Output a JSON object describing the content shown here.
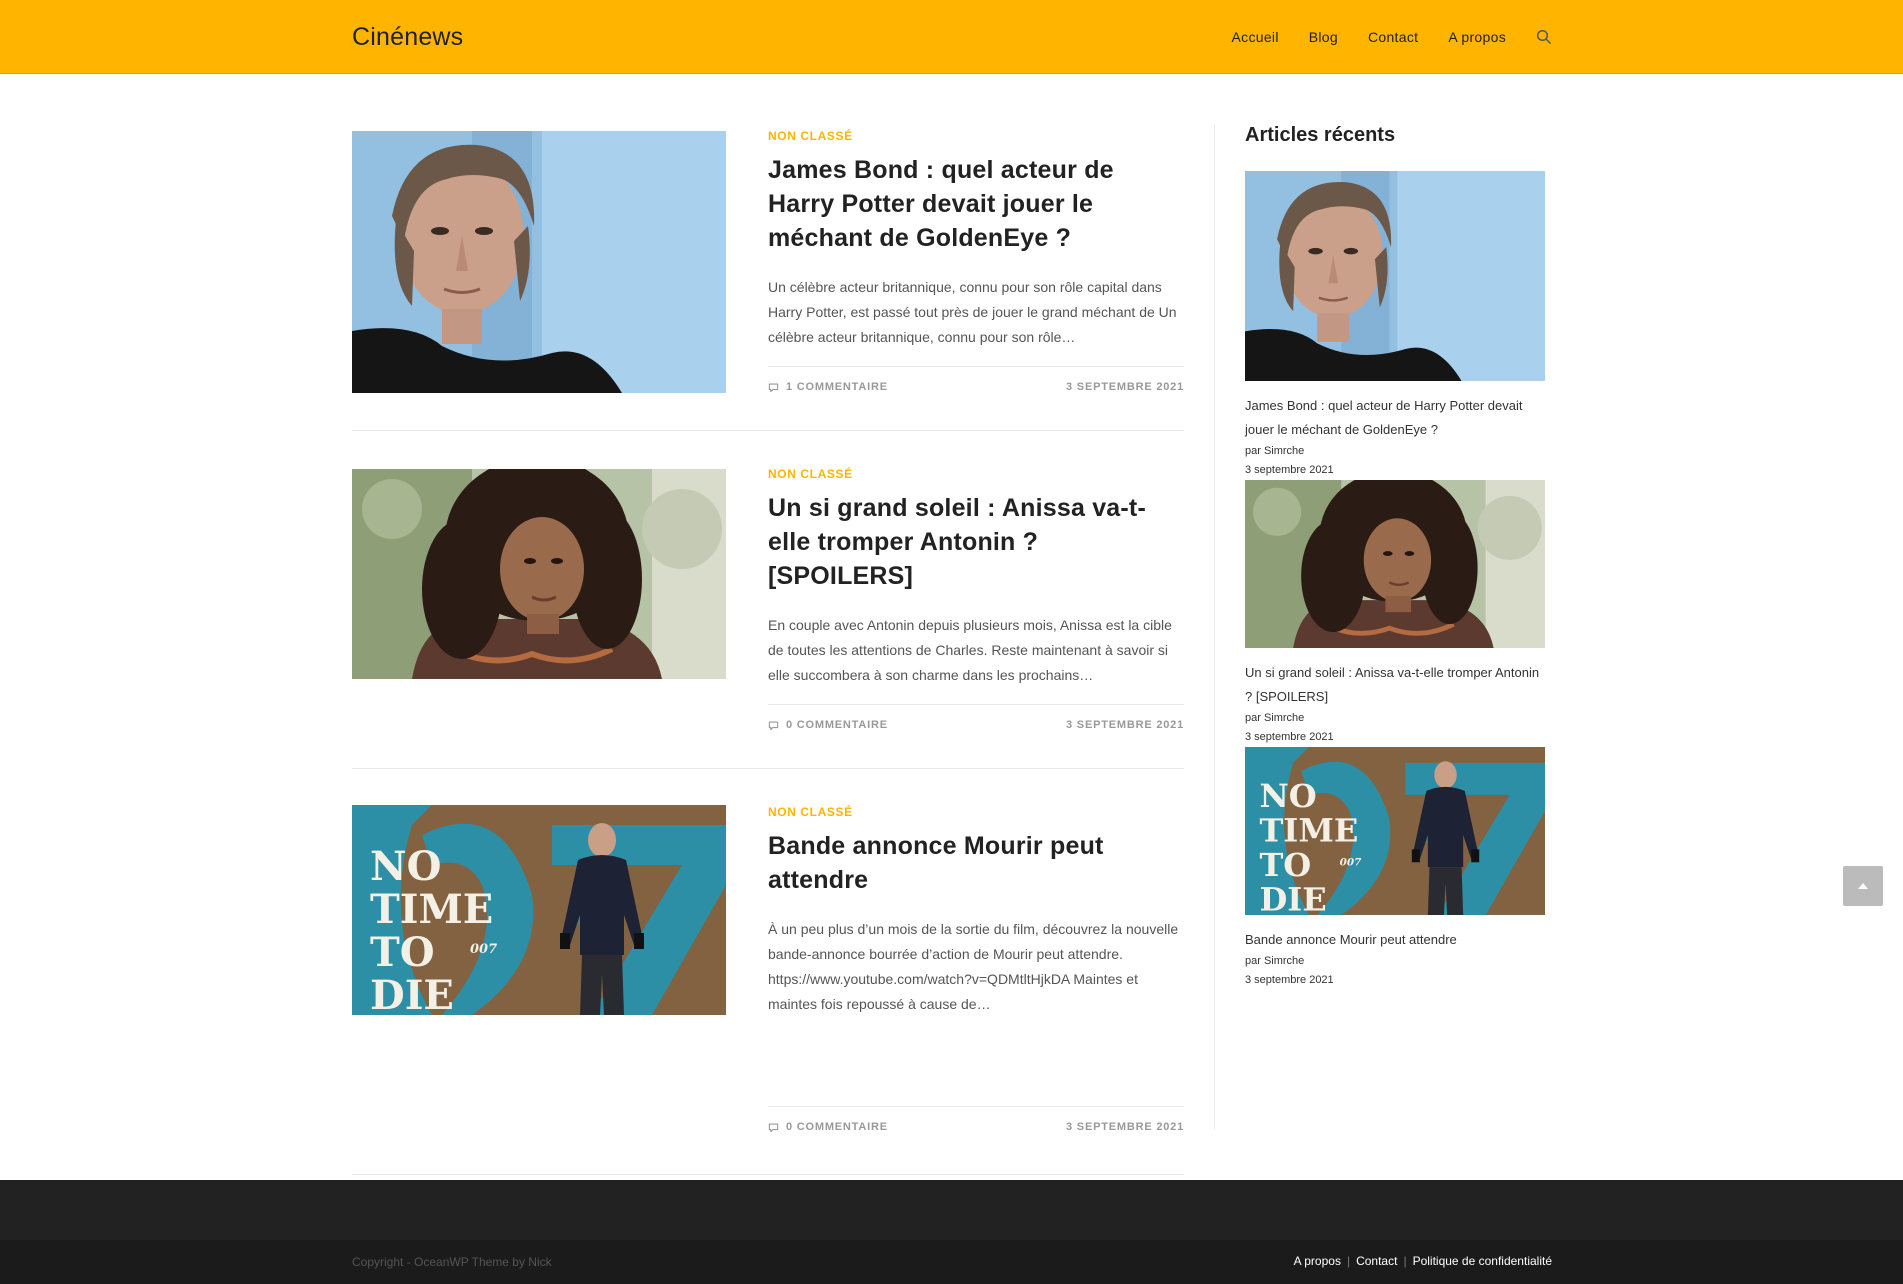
{
  "header": {
    "brand": "Cinénews",
    "nav": [
      "Accueil",
      "Blog",
      "Contact",
      "A propos"
    ]
  },
  "posts": [
    {
      "category": "Non classé",
      "title": "James Bond : quel acteur de Harry Potter devait jouer le méchant de GoldenEye ?",
      "excerpt": "Un célèbre acteur britannique, connu pour son rôle capital dans Harry Potter, est passé tout près de jouer le grand méchant de Un célèbre acteur britannique, connu pour son rôle…",
      "comments": "1 Commentaire",
      "date": "3 septembre 2021"
    },
    {
      "category": "Non classé",
      "title": "Un si grand soleil : Anissa va-t-elle tromper Antonin ? [SPOILERS]",
      "excerpt": "En couple avec Antonin depuis plusieurs mois, Anissa est la cible de toutes les attentions de Charles. Reste maintenant à savoir si elle succombera à son charme dans les prochains…",
      "comments": "0 Commentaire",
      "date": "3 septembre 2021"
    },
    {
      "category": "Non classé",
      "title": "Bande annonce Mourir peut attendre",
      "excerpt": "À un peu plus d’un mois de la sortie du film, découvrez la nouvelle bande-annonce bourrée d’action de Mourir peut attendre. https://www.youtube.com/watch?v=QDMtltHjkDA Maintes et maintes fois repoussé à cause de…",
      "comments": "0 Commentaire",
      "date": "3 septembre 2021"
    }
  ],
  "sidebar": {
    "title": "Articles récents",
    "items": [
      {
        "title": "James Bond : quel acteur de Harry Potter devait jouer le méchant de GoldenEye ?",
        "author": "par Simrche",
        "date": "3 septembre 2021"
      },
      {
        "title": "Un si grand soleil : Anissa va-t-elle tromper Antonin ? [SPOILERS]",
        "author": "par Simrche",
        "date": "3 septembre 2021"
      },
      {
        "title": "Bande annonce Mourir peut attendre",
        "author": "par Simrche",
        "date": "3 septembre 2021"
      }
    ]
  },
  "footer": {
    "copyright": "Copyright - OceanWP Theme by Nick",
    "menu": [
      "A propos",
      "Contact",
      "Politique de confidentialité"
    ]
  },
  "images": {
    "poster_text": [
      "NO",
      "TIME",
      "TO",
      "DIE"
    ],
    "poster_mark": "007"
  },
  "colors": {
    "accent": "#ffb400",
    "footer_dark": "#222222",
    "footer_bottom": "#1b1b1b"
  }
}
